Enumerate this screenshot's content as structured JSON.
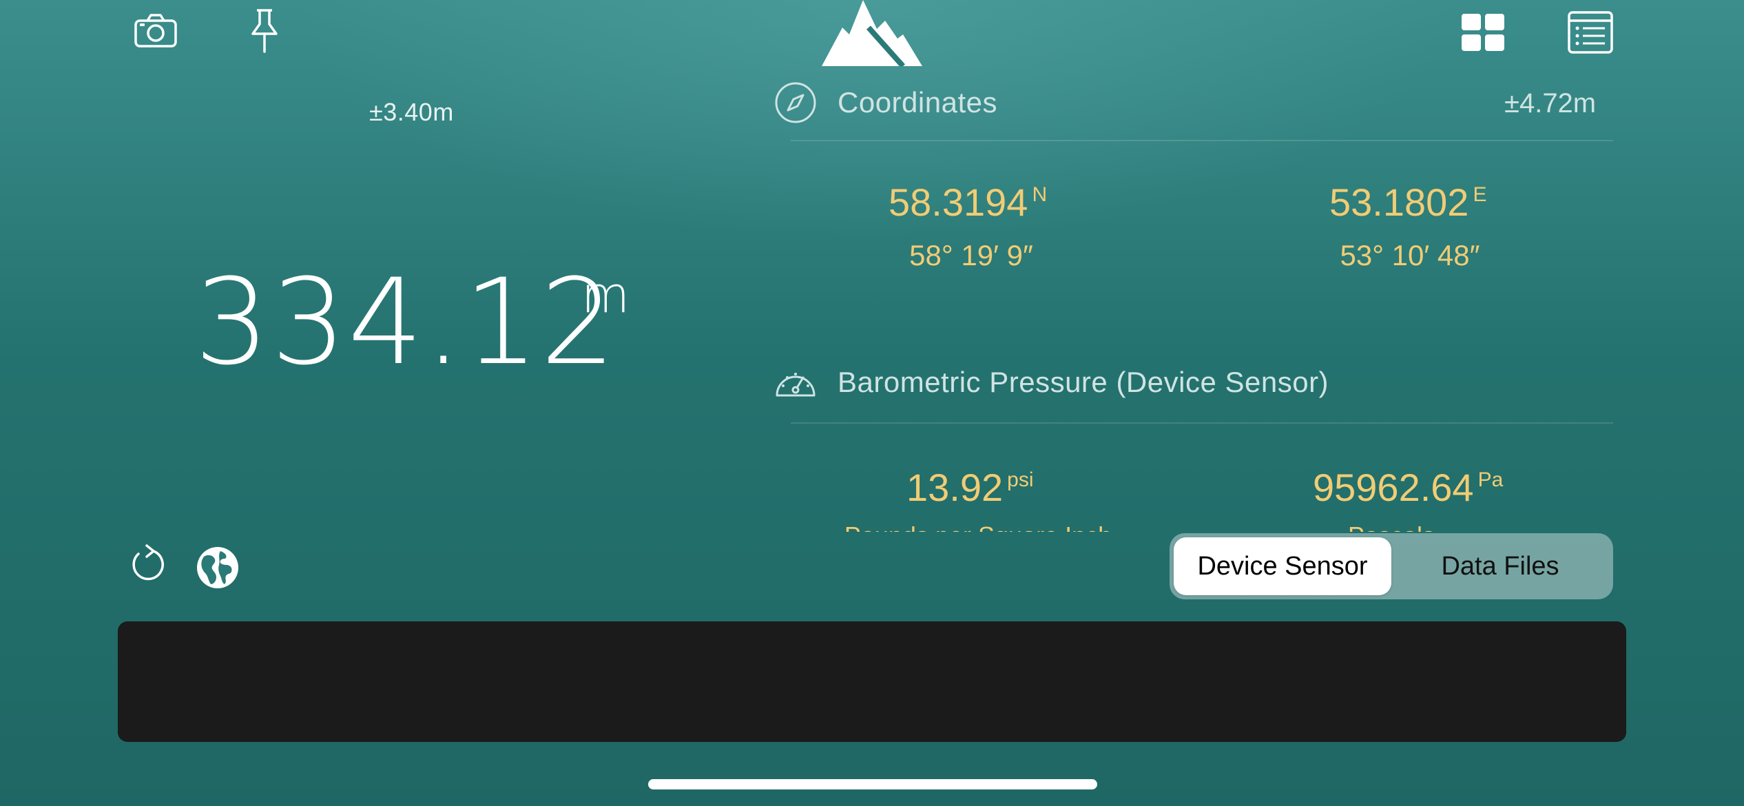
{
  "toolbar": {
    "camera_icon": "camera-icon",
    "pin_icon": "pushpin-icon",
    "logo_icon": "mountain-logo-icon",
    "grid_icon": "grid-view-icon",
    "list_icon": "list-view-icon"
  },
  "altitude": {
    "accuracy": "±3.40m",
    "value": "334.12",
    "unit": "m"
  },
  "coordinates": {
    "title": "Coordinates",
    "accuracy": "±4.72m",
    "latitude_decimal": "58.3194",
    "latitude_hemisphere": "N",
    "latitude_dms": "58° 19′ 9″",
    "longitude_decimal": "53.1802",
    "longitude_hemisphere": "E",
    "longitude_dms": "53° 10′ 48″"
  },
  "pressure": {
    "title": "Barometric Pressure (Device Sensor)",
    "psi_value": "13.92",
    "psi_unit": "psi",
    "psi_label": "Pounds per Square Inch",
    "pa_value": "95962.64",
    "pa_unit": "Pa",
    "pa_label": "Pascals"
  },
  "source_toggle": {
    "options": [
      "Device Sensor",
      "Data Files"
    ],
    "selected": "Device Sensor"
  },
  "colors": {
    "accent_gold": "#f2cc74",
    "background_teal": "#24726f"
  }
}
